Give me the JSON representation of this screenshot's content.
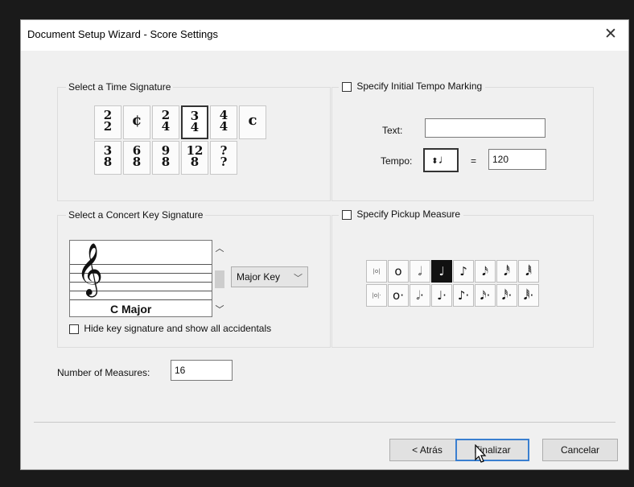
{
  "window": {
    "title": "Document Setup Wizard - Score Settings",
    "close_glyph": "✕"
  },
  "time_signature": {
    "label": "Select a Time Signature",
    "row1": [
      {
        "num": "2",
        "den": "2"
      },
      {
        "single": "¢"
      },
      {
        "num": "2",
        "den": "4"
      },
      {
        "num": "3",
        "den": "4",
        "selected": true
      },
      {
        "num": "4",
        "den": "4"
      },
      {
        "single": "c"
      }
    ],
    "row2": [
      {
        "num": "3",
        "den": "8"
      },
      {
        "num": "6",
        "den": "8"
      },
      {
        "num": "9",
        "den": "8"
      },
      {
        "num": "12",
        "den": "8"
      },
      {
        "num": "?",
        "den": "?"
      }
    ]
  },
  "tempo": {
    "label": "Specify Initial Tempo Marking",
    "text_label": "Text:",
    "text_value": "",
    "tempo_label": "Tempo:",
    "tempo_note": "♩",
    "equals": "=",
    "tempo_value": "120"
  },
  "key_signature": {
    "label": "Select a Concert Key Signature",
    "clef": "𝄞",
    "key_name": "C Major",
    "mode": "Major Key",
    "hide_label": "Hide key signature and show all accidentals"
  },
  "pickup": {
    "label": "Specify Pickup Measure",
    "row1": [
      "|o|",
      "o",
      "𝅗𝅥",
      "♩",
      "♪",
      "𝅘𝅥𝅯",
      "𝅘𝅥𝅰",
      "𝅘𝅥𝅱"
    ],
    "row2": [
      "|o|·",
      "o·",
      "𝅗𝅥·",
      "♩·",
      "♪·",
      "𝅘𝅥𝅯·",
      "𝅘𝅥𝅰·",
      "𝅘𝅥𝅱·"
    ],
    "selected_index": 3
  },
  "measures": {
    "label": "Number of Measures:",
    "value": "16"
  },
  "buttons": {
    "back": "< Atrás",
    "finish": "Finalizar",
    "cancel": "Cancelar"
  }
}
